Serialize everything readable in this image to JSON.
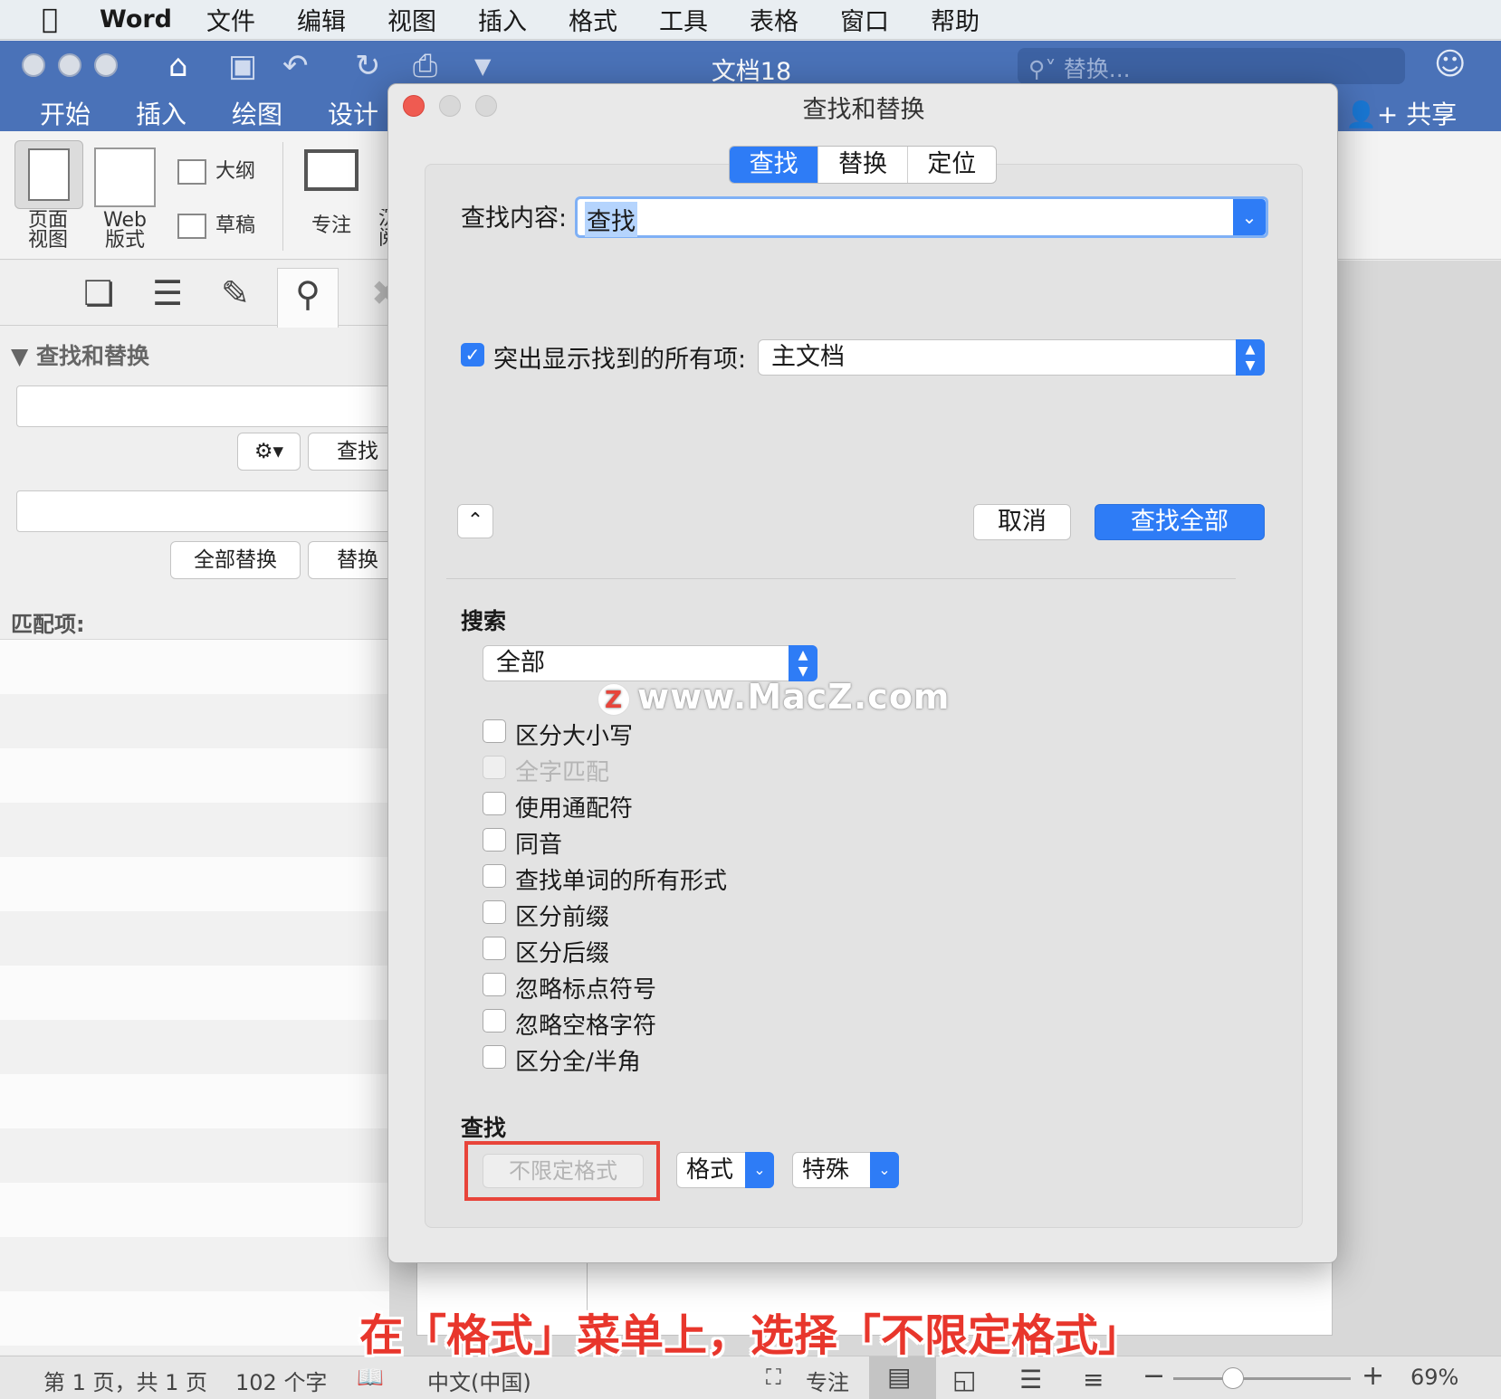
{
  "menubar": {
    "apple_icon": "apple-logo-icon",
    "app_name": "Word",
    "items": [
      "文件",
      "编辑",
      "视图",
      "插入",
      "格式",
      "工具",
      "表格",
      "窗口",
      "帮助"
    ]
  },
  "titlebar": {
    "doc_title": "文档18",
    "search_placeholder": "替换..."
  },
  "ribbon_tabs": {
    "items": [
      "开始",
      "插入",
      "绘图",
      "设计"
    ],
    "share_label": "共享"
  },
  "ribbon": {
    "page_view_label": "页面\n视图",
    "web_view_label": "Web\n版式",
    "outline_label": "大纲",
    "draft_label": "草稿",
    "focus_label": "专注",
    "partial_label": "沉\n阅"
  },
  "left_pane": {
    "section_title": "查找和替换",
    "find_button": "查找",
    "replace_all_button": "全部替换",
    "replace_button": "替换",
    "matches_label": "匹配项:"
  },
  "dialog": {
    "title": "查找和替换",
    "tabs": [
      {
        "label": "查找",
        "active": true
      },
      {
        "label": "替换",
        "active": false
      },
      {
        "label": "定位",
        "active": false
      }
    ],
    "find_label": "查找内容:",
    "find_value": "查找",
    "highlight_label": "突出显示找到的所有项:",
    "highlight_checked": true,
    "highlight_scope": "主文档",
    "cancel_button": "取消",
    "find_all_button": "查找全部",
    "search_section": "搜索",
    "search_scope": "全部",
    "options": [
      {
        "label": "区分大小写",
        "checked": false,
        "disabled": false
      },
      {
        "label": "全字匹配",
        "checked": false,
        "disabled": true
      },
      {
        "label": "使用通配符",
        "checked": false,
        "disabled": false
      },
      {
        "label": "同音",
        "checked": false,
        "disabled": false
      },
      {
        "label": "查找单词的所有形式",
        "checked": false,
        "disabled": false
      },
      {
        "label": "区分前缀",
        "checked": false,
        "disabled": false
      },
      {
        "label": "区分后缀",
        "checked": false,
        "disabled": false
      },
      {
        "label": "忽略标点符号",
        "checked": false,
        "disabled": false
      },
      {
        "label": "忽略空格字符",
        "checked": false,
        "disabled": false
      },
      {
        "label": "区分全/半角",
        "checked": false,
        "disabled": false
      }
    ],
    "find_section": "查找",
    "no_format_button": "不限定格式",
    "format_button": "格式",
    "special_button": "特殊"
  },
  "watermark": "www.MacZ.com",
  "caption": "在「格式」菜单上，选择「不限定格式」",
  "statusbar": {
    "page_info": "第 1 页，共 1 页",
    "word_count": "102 个字",
    "language": "中文(中国)",
    "focus_label": "专注",
    "zoom": "69%"
  },
  "colors": {
    "accent": "#2e7cf6",
    "titlebar": "#4a72b8",
    "caption_red": "#e8362c"
  }
}
